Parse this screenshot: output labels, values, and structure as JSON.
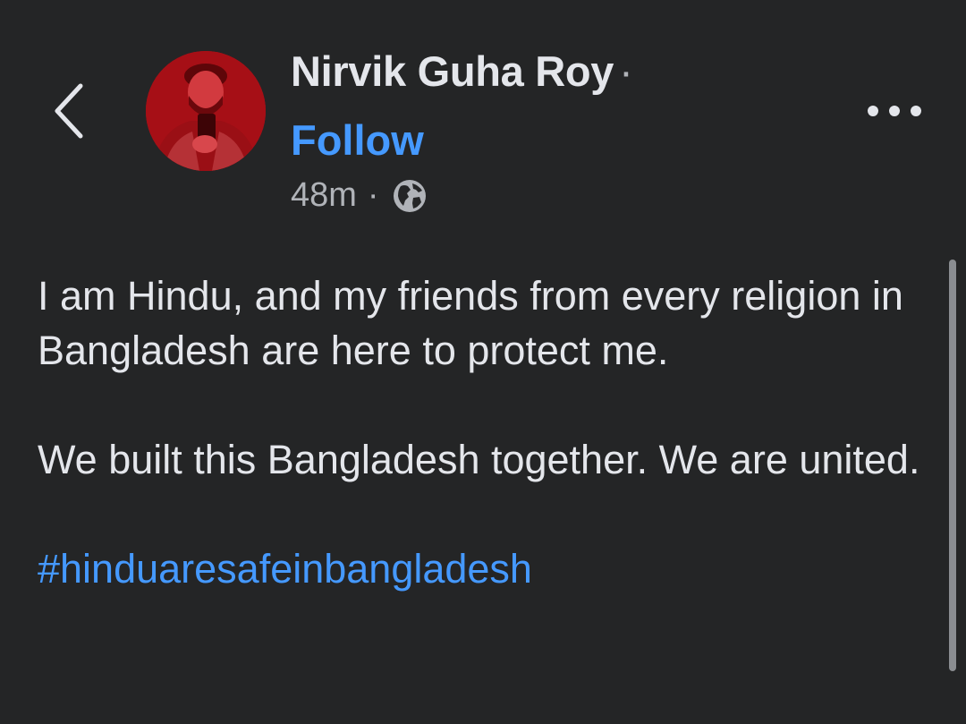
{
  "header": {
    "back_icon": "chevron-left-icon",
    "more_icon": "more-horizontal-icon"
  },
  "author": {
    "name": "Nirvik Guha Roy",
    "name_separator": "·",
    "follow_label": "Follow",
    "avatar_tint": "#b3121a"
  },
  "post_meta": {
    "time": "48m",
    "separator": "·",
    "privacy_icon": "globe-icon"
  },
  "post": {
    "paragraph_1": "I am Hindu, and my friends from every religion in Bangladesh are here to protect me.",
    "paragraph_2": "We built this Bangladesh together. We are united.",
    "hashtag": "#hinduaresafeinbangladesh"
  },
  "colors": {
    "background": "#242526",
    "text_primary": "#e4e6eb",
    "text_secondary": "#b0b3b8",
    "link_blue": "#4599ff"
  }
}
